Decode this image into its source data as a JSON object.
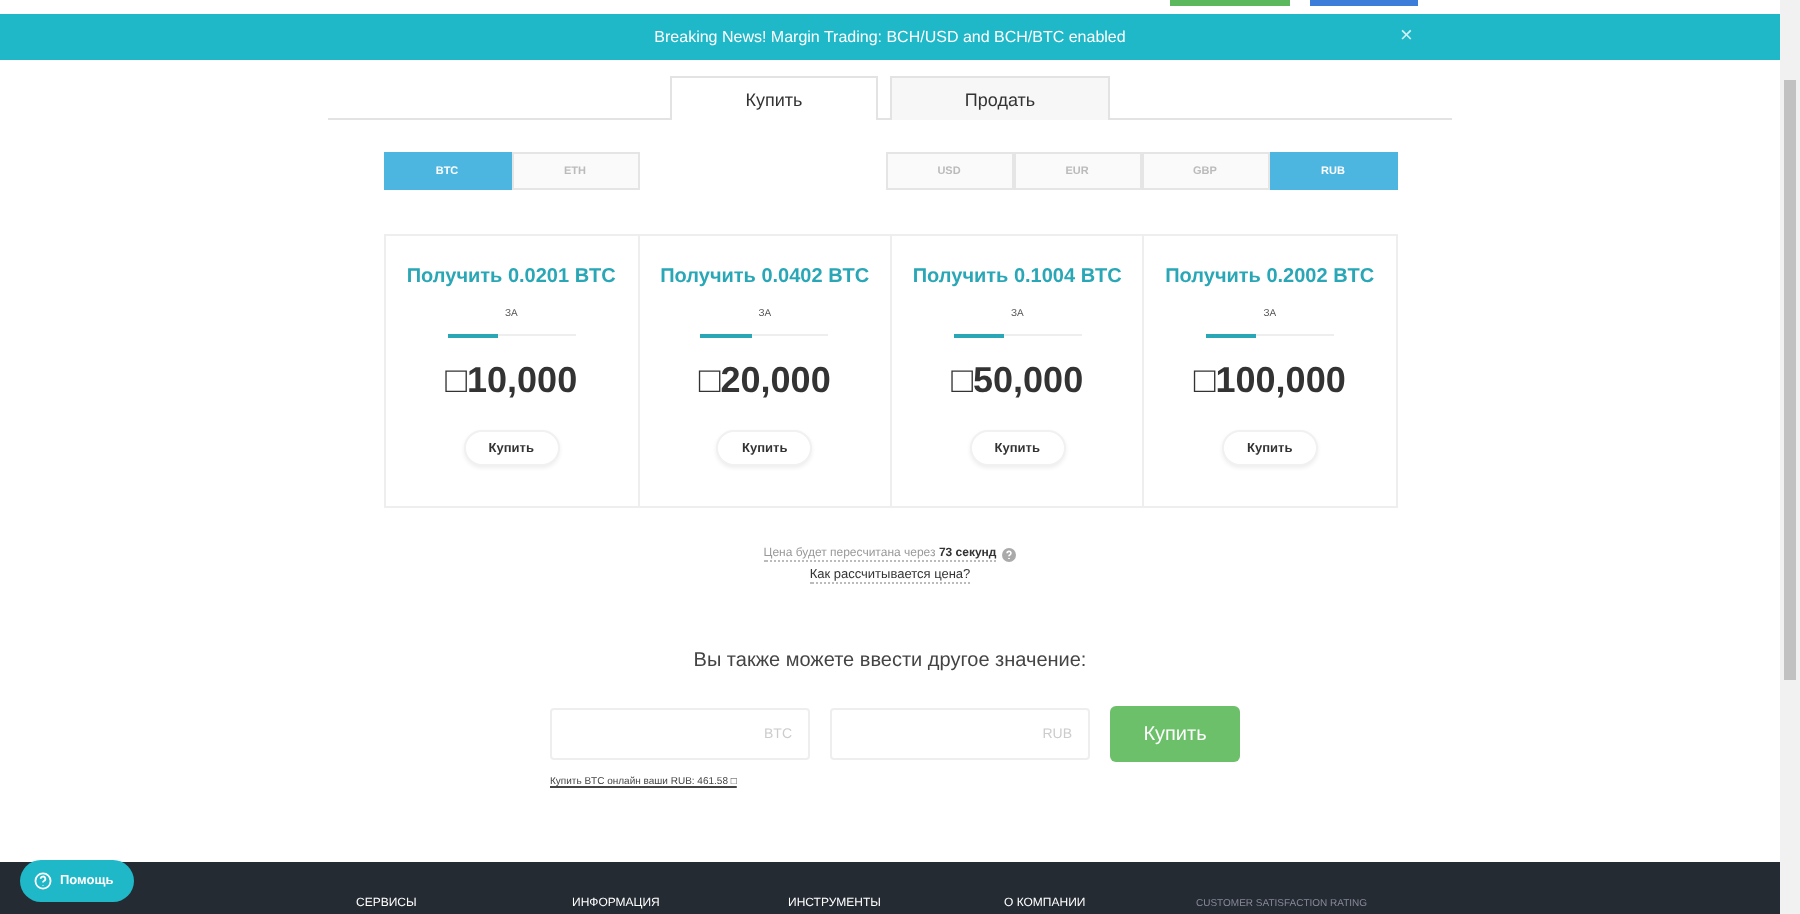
{
  "banner": {
    "text": "Breaking News! Margin Trading: BCH/USD and BCH/BTC enabled",
    "close": "×"
  },
  "tabs": [
    {
      "label": "Купить",
      "selected": true
    },
    {
      "label": "Продать",
      "selected": false
    }
  ],
  "crypto": [
    {
      "label": "BTC",
      "selected": true
    },
    {
      "label": "ETH",
      "selected": false
    }
  ],
  "fiat": [
    {
      "label": "USD",
      "selected": false
    },
    {
      "label": "EUR",
      "selected": false
    },
    {
      "label": "GBP",
      "selected": false
    },
    {
      "label": "RUB",
      "selected": true
    }
  ],
  "offers": [
    {
      "title": "Получить 0.0201 BTC",
      "for": "ЗА",
      "level": 0.4,
      "price": "□10,000",
      "button": "Купить"
    },
    {
      "title": "Получить 0.0402 BTC",
      "for": "ЗА",
      "level": 0.4,
      "price": "□20,000",
      "button": "Купить"
    },
    {
      "title": "Получить 0.1004 BTC",
      "for": "ЗА",
      "level": 0.4,
      "price": "□50,000",
      "button": "Купить"
    },
    {
      "title": "Получить 0.2002 BTC",
      "for": "ЗА",
      "level": 0.4,
      "price": "□100,000",
      "button": "Купить"
    }
  ],
  "timer": "Цена будет пересчитана через **73 секунд**",
  "how_link": "Как рассчитывается цена?",
  "custom": {
    "heading": "Вы также можете ввести другое значение:",
    "btc_placeholder": "BTC",
    "fiat_placeholder": "RUB",
    "button": "Купить",
    "note": "Купить BTC онлайн ваши RUB: 461.58 □"
  },
  "footer": {
    "columns": [
      "СЕРВИСЫ",
      "ИНФОРМАЦИЯ",
      "ИНСТРУМЕНТЫ",
      "О КОМПАНИИ"
    ],
    "rating": "CUSTOMER SATISFACTION RATING"
  },
  "help": {
    "label": "Помощь"
  }
}
